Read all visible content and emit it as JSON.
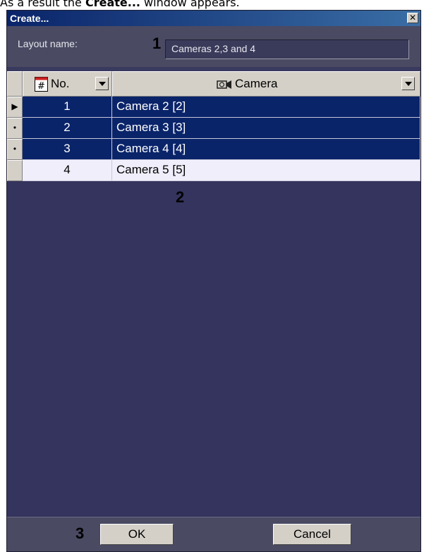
{
  "caption": {
    "prefix": "As a result the ",
    "bold": "Create...",
    "suffix": " window appears."
  },
  "window": {
    "title": "Create...",
    "close_glyph": "✕"
  },
  "layout_name": {
    "label": "Layout name:",
    "marker": "1",
    "value": "Cameras 2,3 and 4"
  },
  "grid": {
    "columns": [
      {
        "icon": "table-number-icon",
        "label": "No."
      },
      {
        "icon": "camera-icon",
        "label": "Camera"
      }
    ],
    "rows": [
      {
        "no": "1",
        "camera": "Camera 2 [2]",
        "selected": true,
        "indicator": "▶"
      },
      {
        "no": "2",
        "camera": "Camera 3 [3]",
        "selected": true,
        "indicator": "•"
      },
      {
        "no": "3",
        "camera": "Camera 4 [4]",
        "selected": true,
        "indicator": "•"
      },
      {
        "no": "4",
        "camera": "Camera 5 [5]",
        "selected": false,
        "indicator": ""
      }
    ],
    "marker": "2"
  },
  "buttons": {
    "marker": "3",
    "ok": "OK",
    "cancel": "Cancel"
  },
  "colors": {
    "selection": "#0a246a",
    "dialog_bg": "#34345e"
  }
}
